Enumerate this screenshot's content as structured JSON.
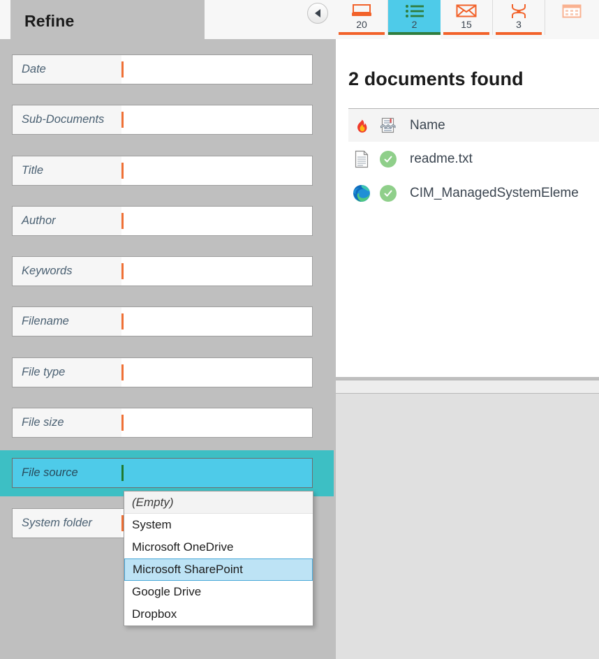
{
  "refine": {
    "tab_label": "Refine",
    "collapse_icon": "collapse-left-icon",
    "fields": [
      {
        "label": "Date",
        "value": "",
        "type": "dropdown"
      },
      {
        "label": "Sub-Documents",
        "value": "",
        "type": "dropdown"
      },
      {
        "label": "Title",
        "value": "",
        "type": "text"
      },
      {
        "label": "Author",
        "value": "",
        "type": "text"
      },
      {
        "label": "Keywords",
        "value": "",
        "type": "text"
      },
      {
        "label": "Filename",
        "value": "",
        "type": "text"
      },
      {
        "label": "File type",
        "value": "",
        "type": "dropdown"
      },
      {
        "label": "File size",
        "value": "",
        "type": "dropdown"
      },
      {
        "label": "File source",
        "value": "",
        "type": "dropdown"
      },
      {
        "label": "System folder",
        "value": "",
        "type": "text"
      }
    ],
    "dropdown": {
      "field": "File source",
      "options": [
        "(Empty)",
        "System",
        "Microsoft OneDrive",
        "Microsoft SharePoint",
        "Google Drive",
        "Dropbox"
      ],
      "selected": "Microsoft SharePoint"
    }
  },
  "tabbar": {
    "tabs": [
      {
        "icon": "archive-box-icon",
        "count": "20",
        "active": false,
        "disabled": false
      },
      {
        "icon": "document-list-icon",
        "count": "2",
        "active": true,
        "disabled": false
      },
      {
        "icon": "envelope-icon",
        "count": "15",
        "active": false,
        "disabled": false
      },
      {
        "icon": "contact-person-icon",
        "count": "3",
        "active": false,
        "disabled": false
      },
      {
        "icon": "calendar-icon",
        "count": "",
        "active": false,
        "disabled": true
      }
    ]
  },
  "results": {
    "title": "2 documents found",
    "columns": {
      "flame_icon": "flame-icon",
      "split-document_icon": "split-document-icon",
      "name": "Name"
    },
    "rows": [
      {
        "file_icon": "text-file-icon",
        "status_icon": "check-circle-icon",
        "name": "readme.txt"
      },
      {
        "file_icon": "edge-browser-icon",
        "status_icon": "check-circle-icon",
        "name": "CIM_ManagedSystemEleme"
      }
    ]
  },
  "colors": {
    "accent_orange": "#f2622a",
    "accent_cyan": "#4ecbe9",
    "highlight_teal": "#3dbfc4",
    "panel_grey": "#bfbfbf",
    "caret_orange": "#ef7035",
    "selection_blue": "#bde3f5",
    "check_green": "#8fcf8a",
    "active_underline_green": "#2f7d3e"
  }
}
